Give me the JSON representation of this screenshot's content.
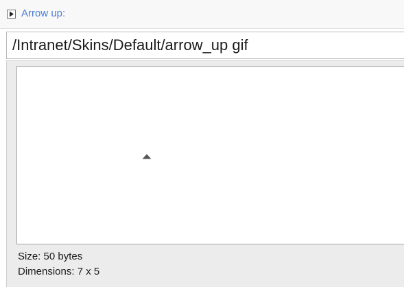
{
  "section": {
    "label": "Arrow up:",
    "toggle_icon": "expand-arrow-icon"
  },
  "path_field": {
    "value": "/Intranet/Skins/Default/arrow_up gif"
  },
  "preview": {
    "image_icon": "arrow-up-icon",
    "size_text": "Size: 50 bytes",
    "dimensions_text": "Dimensions: 7 x 5"
  },
  "colors": {
    "label": "#4a7ed6",
    "text": "#1b1b1b",
    "frame_bg": "#ececec",
    "arrow": "#555555"
  }
}
